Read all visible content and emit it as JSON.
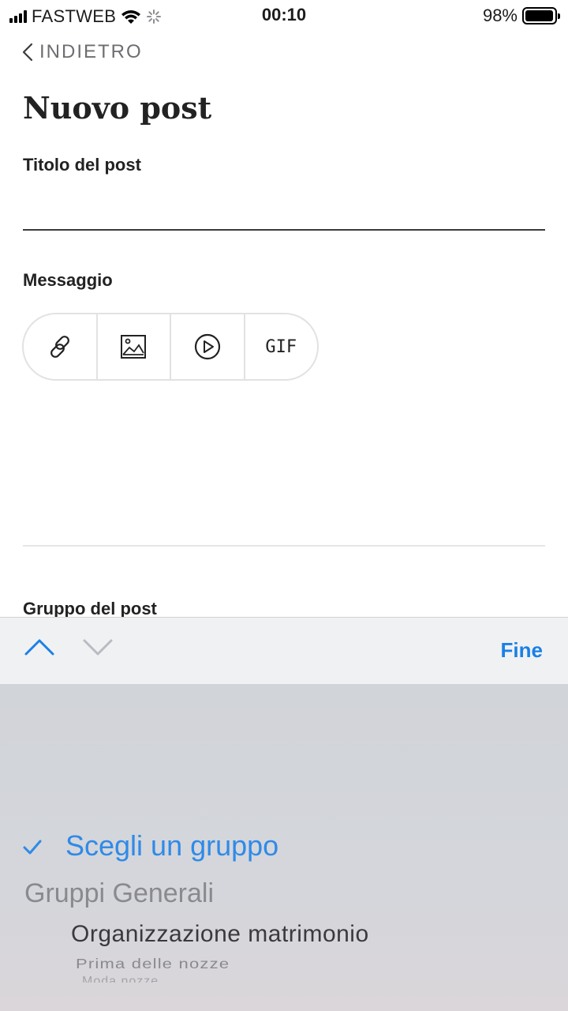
{
  "status_bar": {
    "carrier": "FASTWEB",
    "time": "00:10",
    "battery_pct": "98%",
    "battery_level": 0.98
  },
  "nav": {
    "back_label": "INDIETRO"
  },
  "page": {
    "title": "Nuovo post",
    "title_field_label": "Titolo del post",
    "title_field_value": "",
    "message_label": "Messaggio",
    "group_label": "Gruppo del post"
  },
  "toolbar": {
    "items": [
      {
        "icon": "link-icon"
      },
      {
        "icon": "image-icon"
      },
      {
        "icon": "video-play-icon"
      },
      {
        "icon": "gif-icon",
        "label": "GIF"
      }
    ]
  },
  "accessory_bar": {
    "done_label": "Fine"
  },
  "picker": {
    "selected": "Scegli un gruppo",
    "group_header": "Gruppi Generali",
    "items": [
      "Organizzazione matrimonio",
      "Prima delle nozze",
      "Moda nozze"
    ]
  },
  "colors": {
    "accent": "#1a80e6",
    "picker_selected": "#2f8ae8",
    "picker_bg": "#d1d4d9"
  }
}
